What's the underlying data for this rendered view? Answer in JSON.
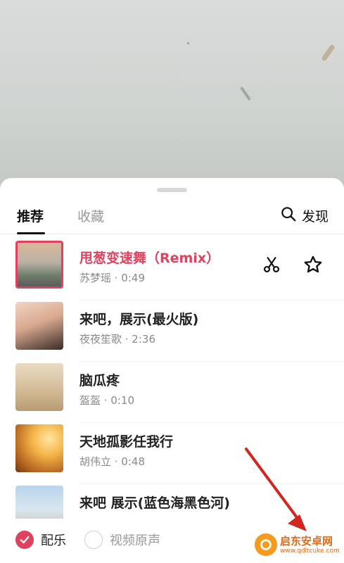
{
  "tabs": {
    "recommended": "推荐",
    "favorites": "收藏",
    "discover": "发现"
  },
  "songs": [
    {
      "title": "甩葱变速舞（Remix）",
      "meta": "苏梦瑶 · 0:49",
      "selected": true
    },
    {
      "title": "来吧，展示(最火版)",
      "meta": "夜夜笙歌 · 2:36"
    },
    {
      "title": "脑瓜疼",
      "meta": "盔盔 · 0:10"
    },
    {
      "title": "天地孤影任我行",
      "meta": "胡伟立 · 0:48"
    },
    {
      "title": "来吧 展示(蓝色海黑色河)",
      "meta": ""
    }
  ],
  "footer": {
    "music_label": "配乐",
    "original_label": "视频原声"
  },
  "watermark": {
    "name": "启东安卓网",
    "url": "www.qdltcuke.com"
  },
  "colors": {
    "accent": "#e0415e",
    "annotation_arrow": "#d2261f"
  }
}
